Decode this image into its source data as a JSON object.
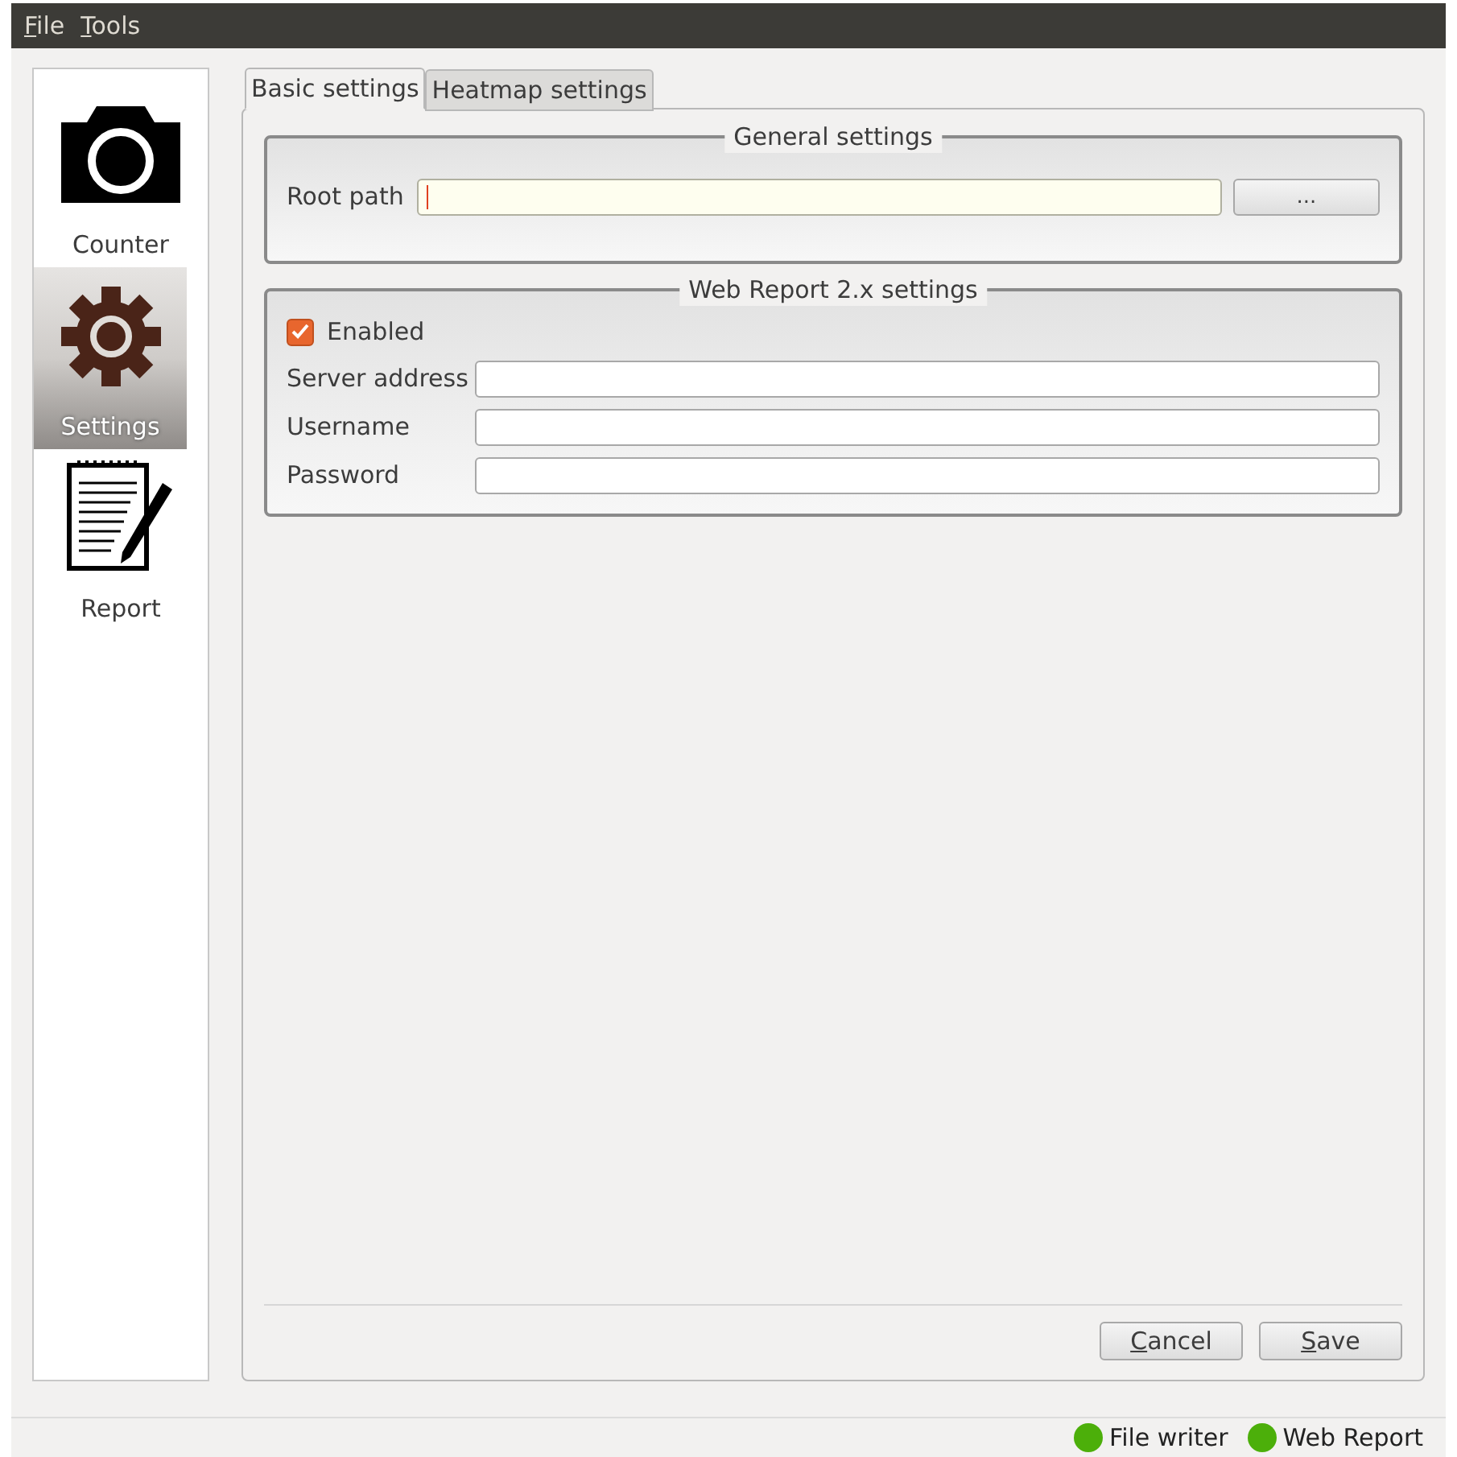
{
  "menu": [
    "File",
    "Tools"
  ],
  "sidebar": {
    "items": [
      {
        "label": "Counter",
        "kind": "camera",
        "selected": false
      },
      {
        "label": "Settings",
        "kind": "gear",
        "selected": true
      },
      {
        "label": "Report",
        "kind": "notepad",
        "selected": false
      }
    ]
  },
  "tabs": [
    {
      "label": "Basic settings",
      "selected": true
    },
    {
      "label": "Heatmap settings",
      "selected": false
    }
  ],
  "general_settings": {
    "title": "General settings",
    "root_path": {
      "label": "Root path",
      "focused": true
    },
    "browse_button": "..."
  },
  "web_report": {
    "title": "Web Report 2.x settings",
    "enabled": {
      "label": "Enabled",
      "checked": true
    },
    "fields": [
      {
        "label": "Server address"
      },
      {
        "label": "Username"
      },
      {
        "label": "Password"
      }
    ]
  },
  "buttons": [
    "Cancel",
    "Save"
  ],
  "status_bar": [
    {
      "label": "File writer",
      "color": "#4caf0a"
    },
    {
      "label": "Web Report",
      "color": "#4caf0a"
    }
  ]
}
